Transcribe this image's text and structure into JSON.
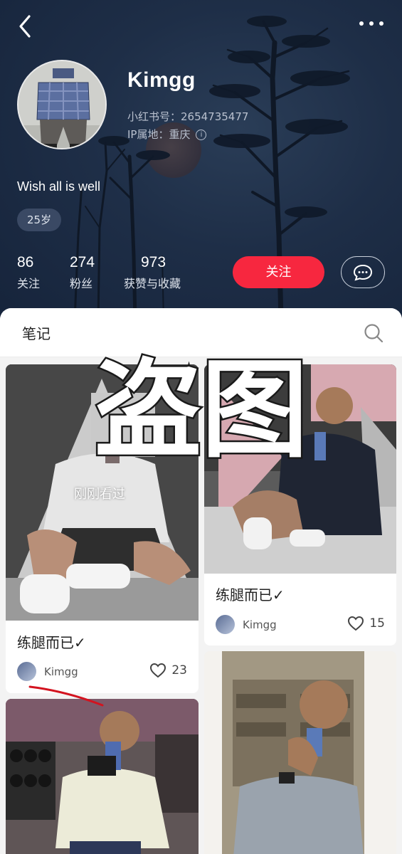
{
  "profile": {
    "name": "Kimgg",
    "id_line": "小红书号：2654735477",
    "ip_line": "IP属地：重庆",
    "bio": "Wish all is well",
    "age_tag": "25岁"
  },
  "stats": [
    {
      "num": "86",
      "label": "关注"
    },
    {
      "num": "274",
      "label": "粉丝"
    },
    {
      "num": "973",
      "label": "获赞与收藏"
    }
  ],
  "actions": {
    "follow": "关注"
  },
  "tabs": {
    "notes": "笔记"
  },
  "overlay": {
    "watermark": "盗图",
    "recent": "刚刚看过"
  },
  "cards": [
    {
      "title": "练腿而已✓",
      "author": "Kimgg",
      "likes": "23"
    },
    {
      "title": "练腿而已✓",
      "author": "Kimgg",
      "likes": "15"
    },
    {},
    {}
  ],
  "icons": {
    "back": "chevron-left-icon",
    "more": "more-dots-icon",
    "search": "search-icon",
    "message": "chat-bubble-icon",
    "like": "heart-outline-icon"
  },
  "colors": {
    "accent": "#f7273f",
    "header_bg": "#1c2b44"
  }
}
